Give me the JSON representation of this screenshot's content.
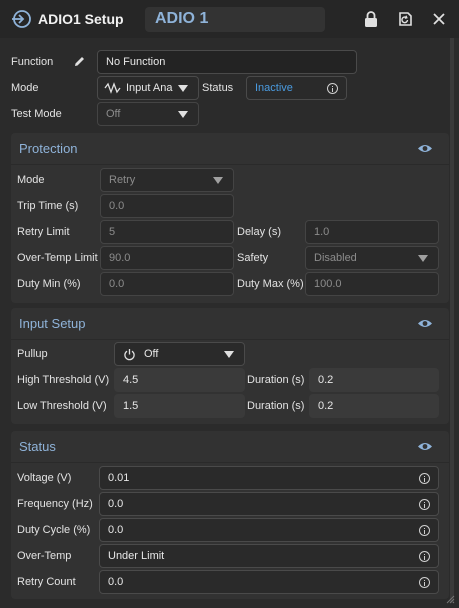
{
  "window": {
    "title": "ADIO1 Setup",
    "name_value": "ADIO 1"
  },
  "top": {
    "function_label": "Function",
    "function_value": "No Function",
    "mode_label": "Mode",
    "mode_value": "Input Ana",
    "status_label": "Status",
    "status_value": "Inactive",
    "test_mode_label": "Test Mode",
    "test_mode_value": "Off"
  },
  "protection": {
    "title": "Protection",
    "mode_label": "Mode",
    "mode_value": "Retry",
    "trip_time_label": "Trip Time (s)",
    "trip_time_value": "0.0",
    "retry_limit_label": "Retry Limit",
    "retry_limit_value": "5",
    "delay_label": "Delay (s)",
    "delay_value": "1.0",
    "overtemp_limit_label": "Over-Temp Limit",
    "overtemp_limit_value": "90.0",
    "safety_label": "Safety",
    "safety_value": "Disabled",
    "duty_min_label": "Duty Min (%)",
    "duty_min_value": "0.0",
    "duty_max_label": "Duty Max (%)",
    "duty_max_value": "100.0"
  },
  "input_setup": {
    "title": "Input Setup",
    "pullup_label": "Pullup",
    "pullup_value": "Off",
    "high_threshold_label": "High Threshold (V)",
    "high_threshold_value": "4.5",
    "high_duration_label": "Duration (s)",
    "high_duration_value": "0.2",
    "low_threshold_label": "Low Threshold (V)",
    "low_threshold_value": "1.5",
    "low_duration_label": "Duration (s)",
    "low_duration_value": "0.2"
  },
  "status": {
    "title": "Status",
    "voltage_label": "Voltage (V)",
    "voltage_value": "0.01",
    "frequency_label": "Frequency (Hz)",
    "frequency_value": "0.0",
    "duty_cycle_label": "Duty Cycle (%)",
    "duty_cycle_value": "0.0",
    "overtemp_label": "Over-Temp",
    "overtemp_value": "Under Limit",
    "retry_count_label": "Retry Count",
    "retry_count_value": "0.0"
  },
  "colors": {
    "accent": "#8fb3d9",
    "status_link": "#4a9be0",
    "background": "#2b2b2b",
    "panel": "#323232"
  }
}
